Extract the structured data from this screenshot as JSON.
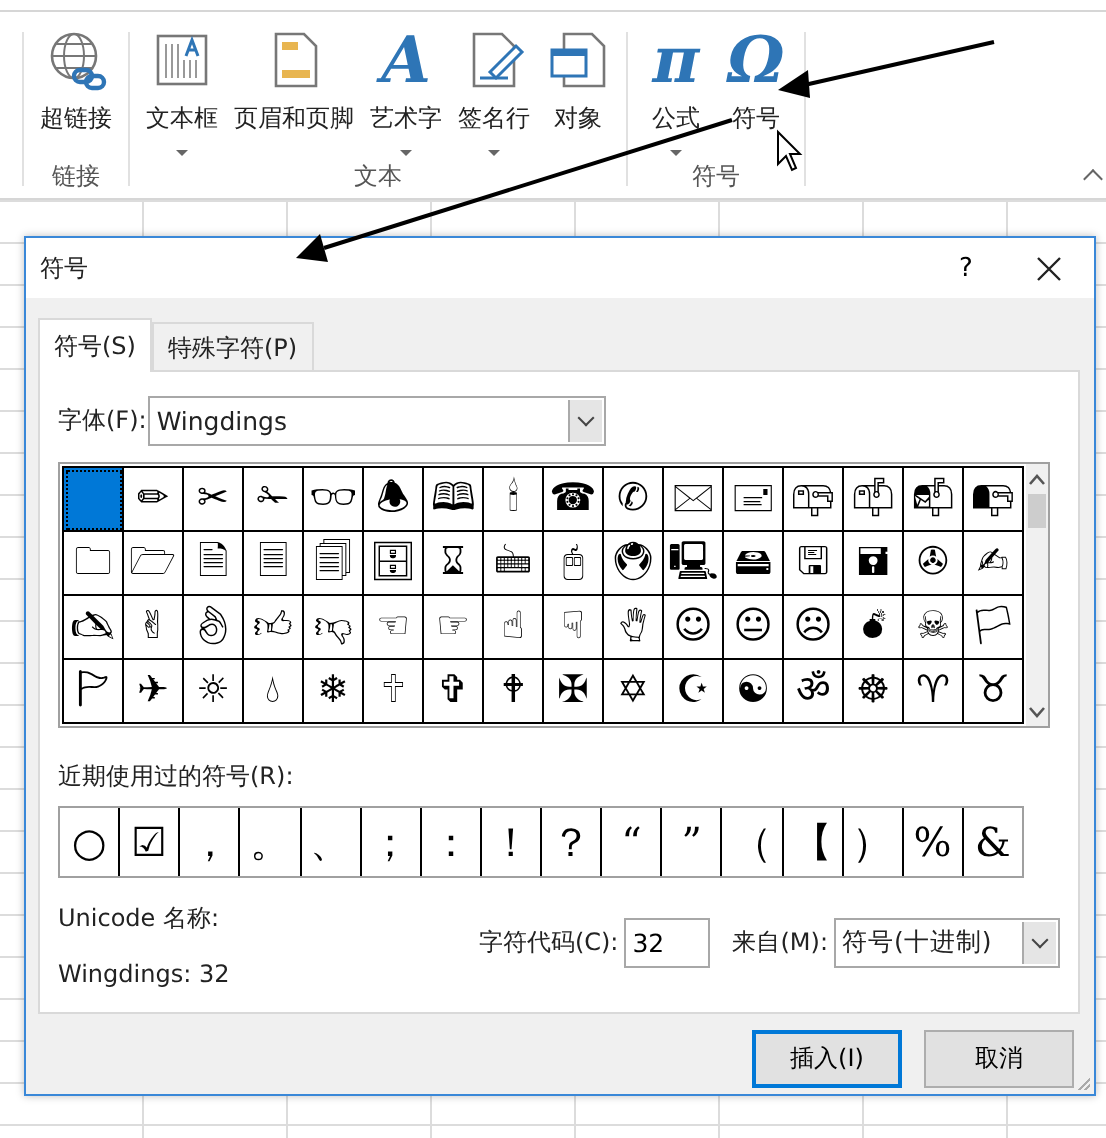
{
  "ribbon": {
    "groups": [
      {
        "label": "链接",
        "items": [
          {
            "kind": "link",
            "label": "超链接",
            "dropdown": false
          }
        ]
      },
      {
        "label": "文本",
        "items": [
          {
            "kind": "textbox",
            "label": "文本框",
            "dropdown": true
          },
          {
            "kind": "header",
            "label": "页眉和页脚",
            "dropdown": false
          },
          {
            "kind": "glyph",
            "glyph": "A",
            "label": "艺术字",
            "dropdown": true
          },
          {
            "kind": "signature",
            "label": "签名行",
            "dropdown": true
          },
          {
            "kind": "object",
            "label": "对象",
            "dropdown": false
          }
        ]
      },
      {
        "label": "符号",
        "items": [
          {
            "kind": "glyph",
            "glyph": "π",
            "label": "公式",
            "dropdown": true
          },
          {
            "kind": "glyph",
            "glyph": "Ω",
            "label": "符号",
            "dropdown": false
          }
        ]
      }
    ]
  },
  "dialog": {
    "title": "符号",
    "help": "?",
    "tabs": [
      {
        "label": "符号(S)",
        "selected": true
      },
      {
        "label": "特殊字符(P)",
        "selected": false
      }
    ],
    "font_label": "字体(F):",
    "font": "Wingdings",
    "symbols": [
      {
        "selected": true
      },
      {
        "symbol": "✏",
        "selected": false
      },
      {
        "symbol": "✂",
        "selected": false
      },
      {
        "symbol": "✁",
        "selected": false
      },
      {
        "symbol": "👓",
        "selected": false
      },
      {
        "symbol": "🕭",
        "selected": false
      },
      {
        "symbol": "🕮",
        "selected": false
      },
      {
        "symbol": "🕯",
        "selected": false
      },
      {
        "symbol": "☎",
        "selected": false
      },
      {
        "symbol": "✆",
        "selected": false
      },
      {
        "symbol": "🖂",
        "selected": false
      },
      {
        "symbol": "🖃",
        "selected": false
      },
      {
        "symbol": "📪",
        "selected": false
      },
      {
        "symbol": "📫",
        "selected": false
      },
      {
        "symbol": "📬",
        "selected": false
      },
      {
        "symbol": "📭",
        "selected": false
      },
      {
        "symbol": "🗀",
        "selected": false
      },
      {
        "symbol": "🗁",
        "selected": false
      },
      {
        "symbol": "🗎",
        "selected": false
      },
      {
        "symbol": "🗏",
        "selected": false
      },
      {
        "symbol": "🗐",
        "selected": false
      },
      {
        "symbol": "🗄",
        "selected": false
      },
      {
        "symbol": "⌛",
        "selected": false
      },
      {
        "symbol": "🖮",
        "selected": false
      },
      {
        "symbol": "🖰",
        "selected": false
      },
      {
        "symbol": "🖲",
        "selected": false
      },
      {
        "symbol": "🖳",
        "selected": false
      },
      {
        "symbol": "🖴",
        "selected": false
      },
      {
        "symbol": "🖫",
        "selected": false
      },
      {
        "symbol": "🖬",
        "selected": false
      },
      {
        "symbol": "✇",
        "selected": false
      },
      {
        "symbol": "✍",
        "selected": false
      },
      {
        "symbol": "🖎",
        "selected": false
      },
      {
        "symbol": "✌",
        "selected": false
      },
      {
        "symbol": "👌",
        "selected": false
      },
      {
        "symbol": "👍",
        "selected": false
      },
      {
        "symbol": "👎",
        "selected": false
      },
      {
        "symbol": "☜",
        "selected": false
      },
      {
        "symbol": "☞",
        "selected": false
      },
      {
        "symbol": "☝",
        "selected": false
      },
      {
        "symbol": "☟",
        "selected": false
      },
      {
        "symbol": "🖐",
        "selected": false
      },
      {
        "symbol": "☺",
        "selected": false
      },
      {
        "symbol": "😐",
        "selected": false
      },
      {
        "symbol": "☹",
        "selected": false
      },
      {
        "symbol": "💣",
        "selected": false
      },
      {
        "symbol": "☠",
        "selected": false
      },
      {
        "symbol": "🏳",
        "selected": false
      },
      {
        "symbol": "🏱",
        "selected": false
      },
      {
        "symbol": "✈",
        "selected": false
      },
      {
        "symbol": "☼",
        "selected": false
      },
      {
        "symbol": "💧",
        "selected": false
      },
      {
        "symbol": "❄",
        "selected": false
      },
      {
        "symbol": "🕆",
        "selected": false
      },
      {
        "symbol": "✞",
        "selected": false
      },
      {
        "symbol": "🕈",
        "selected": false
      },
      {
        "symbol": "✠",
        "selected": false
      },
      {
        "symbol": "✡",
        "selected": false
      },
      {
        "symbol": "☪",
        "selected": false
      },
      {
        "symbol": "☯",
        "selected": false
      },
      {
        "symbol": "ॐ",
        "selected": false
      },
      {
        "symbol": "☸",
        "selected": false
      },
      {
        "symbol": "♈",
        "selected": false
      },
      {
        "symbol": "♉",
        "selected": false
      }
    ],
    "recent_label": "近期使用过的符号(R):",
    "recent": [
      "○",
      "☑",
      "，",
      "。",
      "、",
      "；",
      "：",
      "！",
      "？",
      "“",
      "”",
      "（",
      "【",
      "）",
      "%",
      "&"
    ],
    "unicode_name_label": "Unicode 名称:",
    "unicode_name": "Wingdings: 32",
    "code_label": "字符代码(C):",
    "code": "32",
    "from_label": "来自(M):",
    "from": "符号(十进制)",
    "buttons": [
      {
        "label": "插入(I)",
        "focused": true
      },
      {
        "label": "取消",
        "focused": false
      }
    ]
  }
}
